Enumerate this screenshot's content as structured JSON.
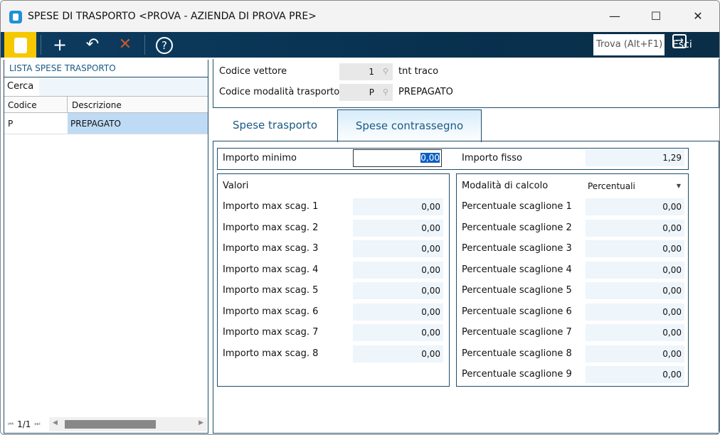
{
  "window": {
    "title": "SPESE DI TRASPORTO <PROVA - AZIENDA DI PROVA PRE>",
    "minimize": "—",
    "maximize": "☐",
    "close": "✕"
  },
  "toolbar": {
    "find_placeholder": "Trova (Alt+F1)",
    "exit_label": "Esci"
  },
  "list": {
    "title": "LISTA SPESE TRASPORTO",
    "search_label": "Cerca",
    "columns": [
      "Codice",
      "Descrizione"
    ],
    "rows": [
      {
        "code": "P",
        "desc": "PREPAGATO"
      }
    ],
    "page": "1/1"
  },
  "header": {
    "carrier_label": "Codice vettore",
    "carrier_code": "1",
    "carrier_name": "tnt traco",
    "mode_label": "Codice modalità trasporto",
    "mode_code": "P",
    "mode_name": "PREPAGATO"
  },
  "tabs": [
    {
      "label": "Spese trasporto"
    },
    {
      "label": "Spese contrassegno",
      "active": true
    }
  ],
  "form": {
    "min_label": "Importo minimo",
    "min_value": "0,00",
    "fixed_label": "Importo fisso",
    "fixed_value": "1,29",
    "values_title": "Valori",
    "calc_label": "Modalità di calcolo",
    "calc_value": "Percentuali",
    "max": [
      {
        "label": "Importo max scag. 1",
        "value": "0,00"
      },
      {
        "label": "Importo max scag. 2",
        "value": "0,00"
      },
      {
        "label": "Importo max scag. 3",
        "value": "0,00"
      },
      {
        "label": "Importo max scag. 4",
        "value": "0,00"
      },
      {
        "label": "Importo max scag. 5",
        "value": "0,00"
      },
      {
        "label": "Importo max scag. 6",
        "value": "0,00"
      },
      {
        "label": "Importo max scag. 7",
        "value": "0,00"
      },
      {
        "label": "Importo max scag. 8",
        "value": "0,00"
      }
    ],
    "perc": [
      {
        "label": "Percentuale scaglione 1",
        "value": "0,00"
      },
      {
        "label": "Percentuale scaglione 2",
        "value": "0,00"
      },
      {
        "label": "Percentuale scaglione 3",
        "value": "0,00"
      },
      {
        "label": "Percentuale scaglione 4",
        "value": "0,00"
      },
      {
        "label": "Percentuale scaglione 5",
        "value": "0,00"
      },
      {
        "label": "Percentuale scaglione 6",
        "value": "0,00"
      },
      {
        "label": "Percentuale scaglione 7",
        "value": "0,00"
      },
      {
        "label": "Percentuale scaglione 8",
        "value": "0,00"
      },
      {
        "label": "Percentuale scaglione 9",
        "value": "0,00"
      }
    ]
  }
}
